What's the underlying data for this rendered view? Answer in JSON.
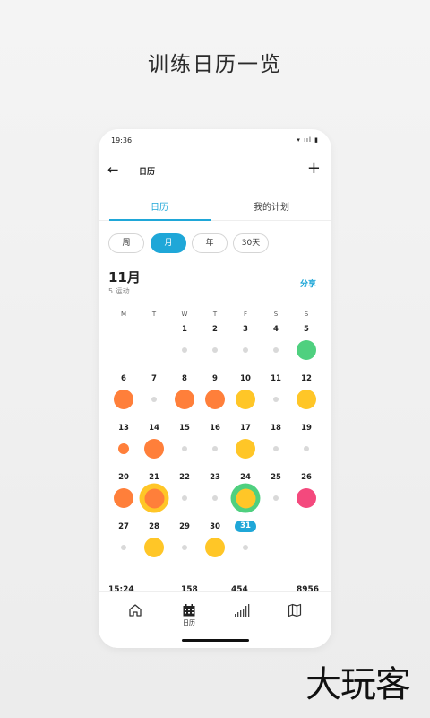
{
  "headline": "训练日历一览",
  "status": {
    "time": "19:36",
    "icons": "▾ ııl ▮"
  },
  "topbar": {
    "title": "日历"
  },
  "tabs": [
    {
      "label": "日历"
    },
    {
      "label": "我的计划"
    }
  ],
  "ranges": [
    {
      "label": "周"
    },
    {
      "label": "月"
    },
    {
      "label": "年"
    },
    {
      "label": "30天"
    }
  ],
  "month": {
    "title": "11月",
    "subtitle": "5 运动",
    "share_label": "分享"
  },
  "weekdays": [
    "M",
    "T",
    "W",
    "T",
    "F",
    "S",
    "S"
  ],
  "colors": {
    "accent": "#1fa7d8",
    "orange": "#ff7f3a",
    "yellow": "#ffc627",
    "green": "#4fd07f",
    "pink": "#f4497d",
    "dot": "#d9d9d9"
  },
  "days": [
    {
      "d": "1",
      "mark": "dot"
    },
    {
      "d": "2",
      "mark": "dot"
    },
    {
      "d": "3",
      "mark": "dot"
    },
    {
      "d": "4",
      "mark": "dot"
    },
    {
      "d": "5",
      "mark": "big",
      "color": "green"
    },
    {
      "d": "6",
      "mark": "big",
      "color": "orange"
    },
    {
      "d": "7",
      "mark": "dot"
    },
    {
      "d": "8",
      "mark": "big",
      "color": "orange"
    },
    {
      "d": "9",
      "mark": "big",
      "color": "orange"
    },
    {
      "d": "10",
      "mark": "big",
      "color": "yellow"
    },
    {
      "d": "11",
      "mark": "dot"
    },
    {
      "d": "12",
      "mark": "big",
      "color": "yellow"
    },
    {
      "d": "13",
      "mark": "small",
      "color": "orange"
    },
    {
      "d": "14",
      "mark": "big",
      "color": "orange"
    },
    {
      "d": "15",
      "mark": "dot"
    },
    {
      "d": "16",
      "mark": "dot"
    },
    {
      "d": "17",
      "mark": "big",
      "color": "yellow"
    },
    {
      "d": "18",
      "mark": "dot"
    },
    {
      "d": "19",
      "mark": "dot"
    },
    {
      "d": "20",
      "mark": "big",
      "color": "orange"
    },
    {
      "d": "21",
      "mark": "ring",
      "color": "orange",
      "ring": "yellow"
    },
    {
      "d": "22",
      "mark": "dot"
    },
    {
      "d": "23",
      "mark": "dot"
    },
    {
      "d": "24",
      "mark": "ring",
      "color": "yellow",
      "ring": "green"
    },
    {
      "d": "25",
      "mark": "dot"
    },
    {
      "d": "26",
      "mark": "big",
      "color": "pink"
    },
    {
      "d": "27",
      "mark": "dot"
    },
    {
      "d": "28",
      "mark": "big",
      "color": "yellow"
    },
    {
      "d": "29",
      "mark": "dot"
    },
    {
      "d": "30",
      "mark": "big",
      "color": "yellow"
    },
    {
      "d": "31",
      "mark": "dot",
      "today": true
    }
  ],
  "stats": [
    "15:24",
    "158",
    "454",
    "8956"
  ],
  "nav": [
    {
      "icon": "home-icon"
    },
    {
      "icon": "calendar-icon",
      "label": "日历"
    },
    {
      "icon": "stats-icon"
    },
    {
      "icon": "map-icon"
    }
  ],
  "watermark": "大玩客"
}
